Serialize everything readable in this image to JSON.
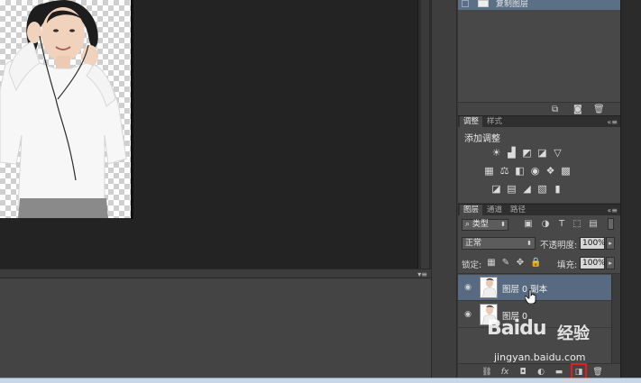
{
  "history": {
    "item_label": "复制图层"
  },
  "adjustments_panel": {
    "tabs": [
      "调整",
      "样式"
    ],
    "title": "添加调整",
    "row1_icons": [
      "brightness-icon",
      "levels-icon",
      "curves-icon",
      "exposure-icon",
      "vibrance-icon"
    ],
    "row2_icons": [
      "hue-saturation-icon",
      "color-balance-icon",
      "black-white-icon",
      "photo-filter-icon",
      "channel-mixer-icon",
      "color-lookup-icon"
    ],
    "row3_icons": [
      "invert-icon",
      "posterize-icon",
      "threshold-icon",
      "selective-color-icon",
      "gradient-map-icon"
    ]
  },
  "layers_panel": {
    "tabs": [
      "图层",
      "通道",
      "路径"
    ],
    "filter_kind": "类型",
    "blend_mode": "正常",
    "opacity_label": "不透明度:",
    "opacity_value": "100%",
    "lock_label": "锁定:",
    "fill_label": "填充:",
    "fill_value": "100%",
    "layers": [
      {
        "name": "图层 0 副本",
        "selected": true
      },
      {
        "name": "图层 0",
        "selected": false
      }
    ]
  },
  "watermark": {
    "brand": "Baidu",
    "cn": "经验",
    "url": "jingyan.baidu.com"
  },
  "colors": {
    "selected_layer": "#586a82",
    "highlight": "#e02020",
    "canvas_bg": "#232323"
  }
}
